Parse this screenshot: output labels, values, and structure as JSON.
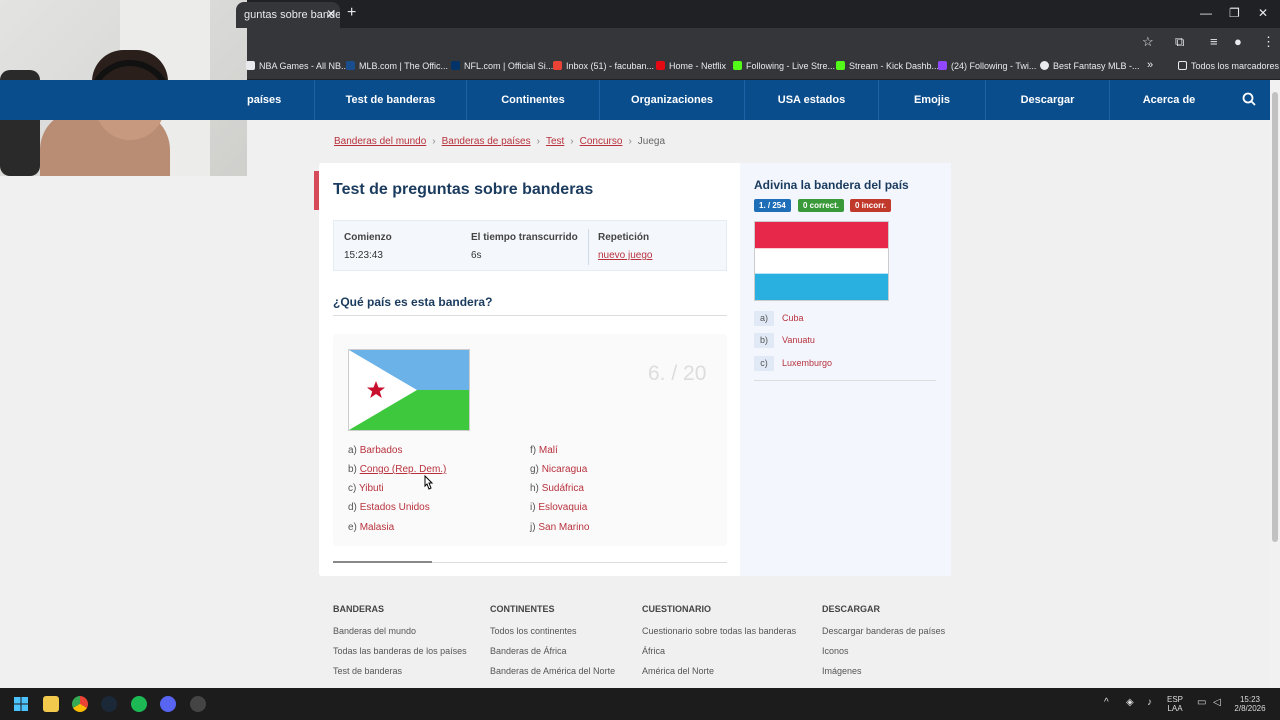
{
  "browser": {
    "tab_title": "guntas sobre bande",
    "tab_close": "✕",
    "new_tab": "+",
    "window_controls": [
      "—",
      "❐",
      "✕"
    ],
    "bookmarks": [
      {
        "label": "NBA Games - All NB...",
        "color": "#e8eaed"
      },
      {
        "label": "MLB.com | The Offic...",
        "color": "#1a4d8c"
      },
      {
        "label": "NFL.com | Official Si...",
        "color": "#013369"
      },
      {
        "label": "Inbox (51) - facuban...",
        "color": "#ea4335"
      },
      {
        "label": "Home - Netflix",
        "color": "#e50914"
      },
      {
        "label": "Following - Live Stre...",
        "color": "#53fc18"
      },
      {
        "label": "Stream - Kick Dashb...",
        "color": "#53fc18"
      },
      {
        "label": "(24) Following - Twi...",
        "color": "#9146ff"
      },
      {
        "label": "Best Fantasy MLB -...",
        "color": "#e8eaed"
      }
    ],
    "bookmarks_more": "»",
    "bookmarks_all": "Todos los marcadores"
  },
  "nav": {
    "items": [
      "países",
      "Test de banderas",
      "Continentes",
      "Organizaciones",
      "USA estados",
      "Emojis",
      "Descargar",
      "Acerca de"
    ],
    "bg_color": "#0a4d8c"
  },
  "breadcrumb": {
    "items": [
      "Banderas del mundo",
      "Banderas de países",
      "Test",
      "Concurso"
    ],
    "current": "Juega",
    "separator": "›"
  },
  "quiz": {
    "title": "Test de preguntas sobre banderas",
    "start_label": "Comienzo",
    "start_value": "15:23:43",
    "elapsed_label": "El tiempo transcurrido",
    "elapsed_value": "6s",
    "repeat_label": "Repetición",
    "repeat_link": "nuevo juego",
    "question": "¿Qué país es esta bandera?",
    "counter": "6. / 20",
    "progress_fraction": 0.25,
    "flag_country": "Djibouti",
    "options_left": [
      {
        "letter": "a)",
        "text": "Barbados"
      },
      {
        "letter": "b)",
        "text": "Congo (Rep. Dem.)"
      },
      {
        "letter": "c)",
        "text": "Yibuti"
      },
      {
        "letter": "d)",
        "text": "Estados Unidos"
      },
      {
        "letter": "e)",
        "text": "Malasia"
      }
    ],
    "options_right": [
      {
        "letter": "f)",
        "text": "Malí"
      },
      {
        "letter": "g)",
        "text": "Nicaragua"
      },
      {
        "letter": "h)",
        "text": "Sudáfrica"
      },
      {
        "letter": "i)",
        "text": "Eslovaquia"
      },
      {
        "letter": "j)",
        "text": "San Marino"
      }
    ]
  },
  "side_quiz": {
    "title": "Adivina la bandera del país",
    "badge_count": "1. / 254",
    "badge_correct": "0 correct.",
    "badge_incorrect": "0 incorr.",
    "flag_country": "Luxembourg",
    "options": [
      {
        "letter": "a)",
        "text": "Cuba"
      },
      {
        "letter": "b)",
        "text": "Vanuatu"
      },
      {
        "letter": "c)",
        "text": "Luxemburgo"
      }
    ]
  },
  "footer": {
    "columns": [
      {
        "head": "BANDERAS",
        "links": [
          "Banderas del mundo",
          "Todas las banderas de los países",
          "Test de banderas"
        ]
      },
      {
        "head": "CONTINENTES",
        "links": [
          "Todos los continentes",
          "Banderas de África",
          "Banderas de América del Norte"
        ]
      },
      {
        "head": "CUESTIONARIO",
        "links": [
          "Cuestionario sobre todas las banderas",
          "África",
          "América del Norte"
        ]
      },
      {
        "head": "DESCARGAR",
        "links": [
          "Descargar banderas de países",
          "Iconos",
          "Imágenes"
        ]
      }
    ]
  },
  "taskbar": {
    "lang_top": "ESP",
    "lang_bottom": "LAA",
    "time": "15:23",
    "date": "2/8/2026"
  }
}
